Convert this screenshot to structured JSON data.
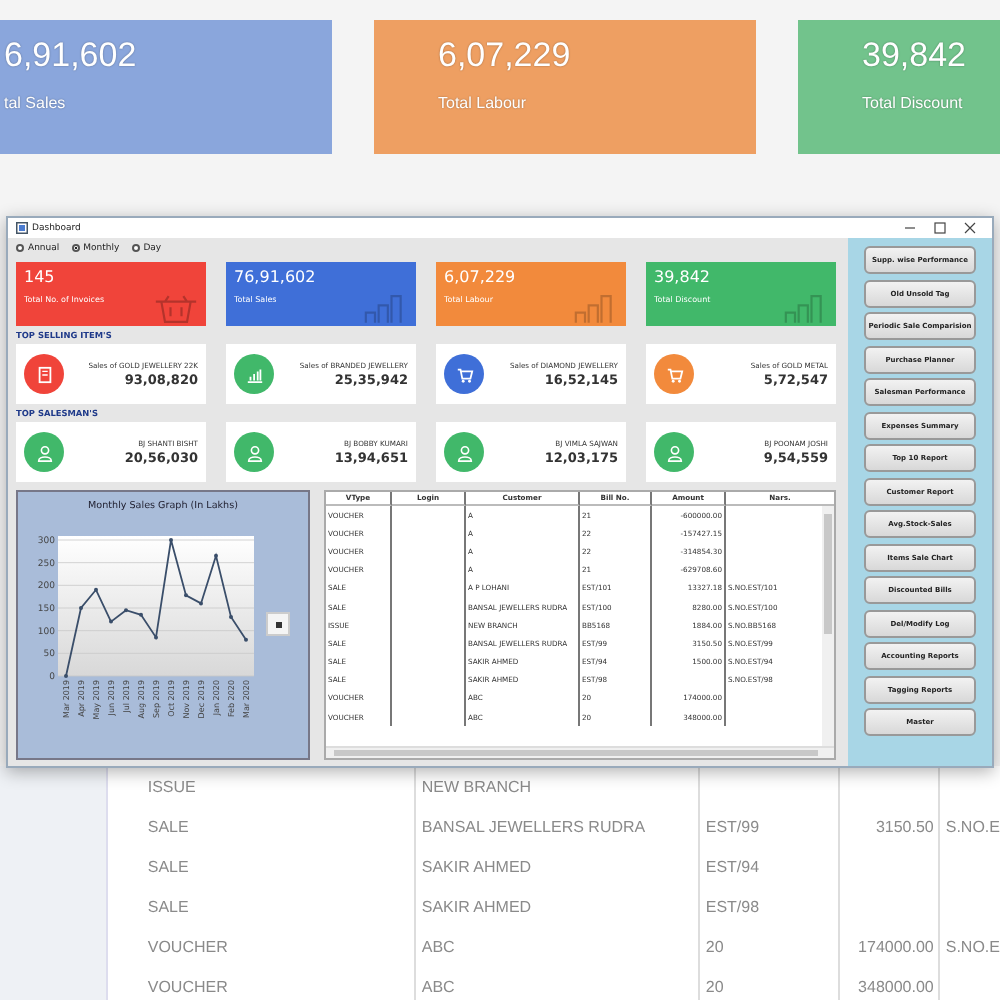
{
  "background": {
    "cards": [
      {
        "value": "6,91,602",
        "label": "tal Sales",
        "color": "#8aa6dc"
      },
      {
        "value": "6,07,229",
        "label": "Total Labour",
        "color": "#ee9f62"
      },
      {
        "value": "39,842",
        "label": "Total Discount",
        "color": "#72c38c"
      }
    ],
    "rows": [
      {
        "vtype": "ISSUE",
        "customer": "NEW BRANCH"
      },
      {
        "vtype": "SALE",
        "customer": "BANSAL JEWELLERS RUDRA",
        "bill": "EST/99",
        "amount": "3150.50",
        "nars": "S.NO.E"
      },
      {
        "vtype": "SALE",
        "customer": "SAKIR AHMED",
        "bill": "EST/94"
      },
      {
        "vtype": "SALE",
        "customer": "SAKIR AHMED",
        "bill": "EST/98"
      },
      {
        "vtype": "VOUCHER",
        "customer": "ABC",
        "bill": "20",
        "amount": "174000.00",
        "nars": "S.NO.E"
      },
      {
        "vtype": "VOUCHER",
        "customer": "ABC",
        "bill": "20",
        "amount": "348000.00"
      }
    ]
  },
  "window": {
    "title": "Dashboard"
  },
  "periods": [
    {
      "label": "Annual",
      "selected": false
    },
    {
      "label": "Monthly",
      "selected": true
    },
    {
      "label": "Day",
      "selected": false
    }
  ],
  "kpis": [
    {
      "value": "145",
      "label": "Total No. of Invoices",
      "color": "#f0443a",
      "kind": "basket"
    },
    {
      "value": "76,91,602",
      "label": "Total Sales",
      "color": "#3f6fd8",
      "kind": "bars"
    },
    {
      "value": "6,07,229",
      "label": "Total Labour",
      "color": "#f28a3c",
      "kind": "bars"
    },
    {
      "value": "39,842",
      "label": "Total Discount",
      "color": "#41b86a",
      "kind": "bars"
    }
  ],
  "top_selling": {
    "title": "TOP SELLING ITEM'S",
    "items": [
      {
        "label": "Sales of GOLD JEWELLERY 22K",
        "value": "93,08,820",
        "color": "#f0443a",
        "kind": "book"
      },
      {
        "label": "Sales of BRANDED JEWELLERY",
        "value": "25,35,942",
        "color": "#41b86a",
        "kind": "chart"
      },
      {
        "label": "Sales of DIAMOND JEWELLERY",
        "value": "16,52,145",
        "color": "#3f6fd8",
        "kind": "cart"
      },
      {
        "label": "Sales of GOLD METAL",
        "value": "5,72,547",
        "color": "#f28a3c",
        "kind": "cart"
      }
    ]
  },
  "top_salesmen": {
    "title": "TOP SALESMAN'S",
    "items": [
      {
        "label": "BJ SHANTI BISHT",
        "value": "20,56,030",
        "color": "#41b86a",
        "kind": "person"
      },
      {
        "label": "BJ BOBBY KUMARI",
        "value": "13,94,651",
        "color": "#41b86a",
        "kind": "person"
      },
      {
        "label": "BJ VIMLA SAJWAN",
        "value": "12,03,175",
        "color": "#41b86a",
        "kind": "person"
      },
      {
        "label": "BJ POONAM JOSHI",
        "value": "9,54,559",
        "color": "#41b86a",
        "kind": "person"
      }
    ]
  },
  "chart": {
    "chart_data": {
      "type": "line",
      "title": "Monthly Sales Graph (In Lakhs)",
      "categories": [
        "Mar 2019",
        "Apr 2019",
        "May 2019",
        "Jun 2019",
        "Jul 2019",
        "Aug 2019",
        "Sep 2019",
        "Oct 2019",
        "Nov 2019",
        "Dec 2019",
        "Jan 2020",
        "Feb 2020",
        "Mar 2020"
      ],
      "grid": true,
      "series": [
        {
          "color": "#3a4e6a",
          "values": [
            0,
            150,
            190,
            120,
            145,
            135,
            85,
            300,
            178,
            160,
            265,
            130,
            80
          ]
        }
      ],
      "ylim": [
        0,
        300
      ],
      "yticks": [
        0,
        50,
        100,
        150,
        200,
        250,
        300
      ]
    }
  },
  "table": {
    "columns": [
      "VType",
      "Login",
      "Customer",
      "Bill No.",
      "Amount",
      "Nars."
    ],
    "rows": [
      {
        "vtype": "VOUCHER",
        "customer": "A",
        "bill": "21",
        "amount": "-600000.00"
      },
      {
        "vtype": "VOUCHER",
        "customer": "A",
        "bill": "22",
        "amount": "-157427.15"
      },
      {
        "vtype": "VOUCHER",
        "customer": "A",
        "bill": "22",
        "amount": "-314854.30"
      },
      {
        "vtype": "VOUCHER",
        "customer": "A",
        "bill": "21",
        "amount": "-629708.60"
      },
      {
        "vtype": "SALE",
        "customer": "A P LOHANI",
        "bill": "EST/101",
        "amount": "13327.18",
        "nars": "S.NO.EST/101"
      },
      {
        "vtype": "SALE",
        "customer": "BANSAL JEWELLERS RUDRA",
        "bill": "EST/100",
        "amount": "8280.00",
        "nars": "S.NO.EST/100"
      },
      {
        "vtype": "ISSUE",
        "customer": "NEW BRANCH",
        "bill": "BB5168",
        "amount": "1884.00",
        "nars": "S.NO.BB5168"
      },
      {
        "vtype": "SALE",
        "customer": "BANSAL JEWELLERS RUDRA",
        "bill": "EST/99",
        "amount": "3150.50",
        "nars": "S.NO.EST/99"
      },
      {
        "vtype": "SALE",
        "customer": "SAKIR AHMED",
        "bill": "EST/94",
        "amount": "1500.00",
        "nars": "S.NO.EST/94"
      },
      {
        "vtype": "SALE",
        "customer": "SAKIR AHMED",
        "bill": "EST/98",
        "nars": "S.NO.EST/98"
      },
      {
        "vtype": "VOUCHER",
        "customer": "ABC",
        "bill": "20",
        "amount": "174000.00"
      },
      {
        "vtype": "VOUCHER",
        "customer": "ABC",
        "bill": "20",
        "amount": "348000.00"
      }
    ]
  },
  "side_buttons": [
    "Supp. wise Performance",
    "Old Unsold Tag",
    "Periodic Sale Comparision",
    "Purchase Planner",
    "Salesman Performance",
    "Expenses Summary",
    "Top 10 Report",
    "Customer Report",
    "Avg.Stock-Sales",
    "Items Sale Chart",
    "Discounted Bills",
    "Del/Modify Log",
    "Accounting Reports",
    "Tagging Reports",
    "Master"
  ]
}
